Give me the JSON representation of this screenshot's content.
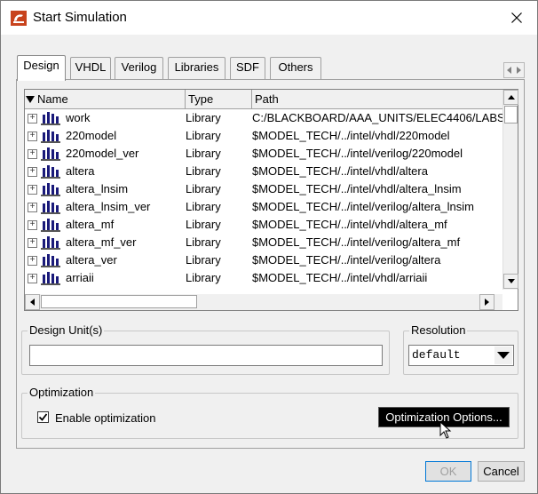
{
  "window": {
    "title": "Start Simulation"
  },
  "tabs": [
    {
      "label": "Design",
      "active": true
    },
    {
      "label": "VHDL"
    },
    {
      "label": "Verilog"
    },
    {
      "label": "Libraries"
    },
    {
      "label": "SDF"
    },
    {
      "label": "Others"
    }
  ],
  "list": {
    "columns": {
      "name": "Name",
      "type": "Type",
      "path": "Path"
    },
    "rows": [
      {
        "name": "work",
        "type": "Library",
        "path": "C:/BLACKBOARD/AAA_UNITS/ELEC4406/LABS"
      },
      {
        "name": "220model",
        "type": "Library",
        "path": "$MODEL_TECH/../intel/vhdl/220model"
      },
      {
        "name": "220model_ver",
        "type": "Library",
        "path": "$MODEL_TECH/../intel/verilog/220model"
      },
      {
        "name": "altera",
        "type": "Library",
        "path": "$MODEL_TECH/../intel/vhdl/altera"
      },
      {
        "name": "altera_lnsim",
        "type": "Library",
        "path": "$MODEL_TECH/../intel/vhdl/altera_lnsim"
      },
      {
        "name": "altera_lnsim_ver",
        "type": "Library",
        "path": "$MODEL_TECH/../intel/verilog/altera_lnsim"
      },
      {
        "name": "altera_mf",
        "type": "Library",
        "path": "$MODEL_TECH/../intel/vhdl/altera_mf"
      },
      {
        "name": "altera_mf_ver",
        "type": "Library",
        "path": "$MODEL_TECH/../intel/verilog/altera_mf"
      },
      {
        "name": "altera_ver",
        "type": "Library",
        "path": "$MODEL_TECH/../intel/verilog/altera"
      },
      {
        "name": "arriaii",
        "type": "Library",
        "path": "$MODEL_TECH/../intel/vhdl/arriaii"
      }
    ]
  },
  "design_unit": {
    "label": "Design Unit(s)",
    "value": ""
  },
  "resolution": {
    "label": "Resolution",
    "value": "default"
  },
  "optimization": {
    "label": "Optimization",
    "enable_label": "Enable optimization",
    "enabled": true,
    "options_button": "Optimization Options..."
  },
  "buttons": {
    "ok": "OK",
    "cancel": "Cancel"
  },
  "colors": {
    "library_icon": "#1a1a7a",
    "tab_border": "#a0a0a0"
  }
}
